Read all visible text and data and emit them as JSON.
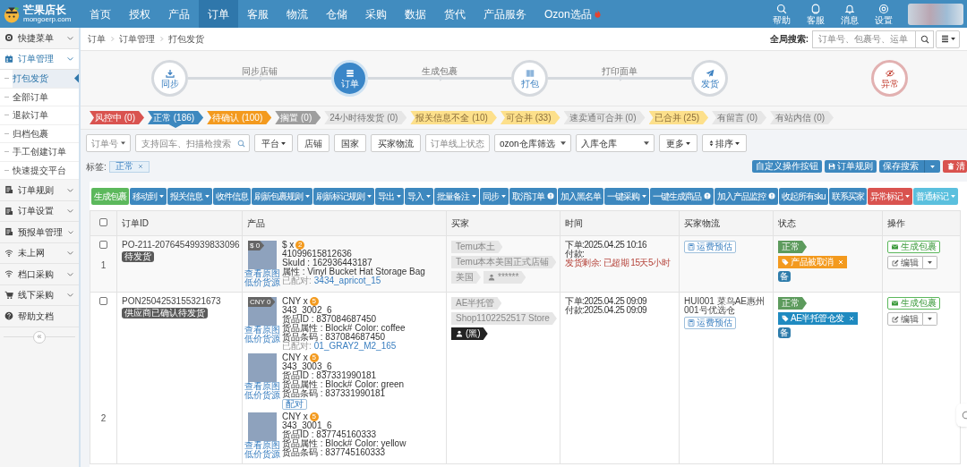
{
  "nav": {
    "logo": {
      "name": "芒果店长",
      "domain": "mongoerp.com"
    },
    "items": [
      {
        "label": "首页",
        "selected": false
      },
      {
        "label": "授权",
        "selected": false
      },
      {
        "label": "产品",
        "selected": false
      },
      {
        "label": "订单",
        "selected": true
      },
      {
        "label": "客服",
        "selected": false
      },
      {
        "label": "物流",
        "selected": false
      },
      {
        "label": "仓储",
        "selected": false
      },
      {
        "label": "采购",
        "selected": false
      },
      {
        "label": "数据",
        "selected": false
      },
      {
        "label": "货代",
        "selected": false
      },
      {
        "label": "产品服务",
        "selected": false
      },
      {
        "label": "Ozon选品",
        "selected": false,
        "hot": true
      }
    ],
    "tools": [
      {
        "label": "帮助",
        "kind": "search"
      },
      {
        "label": "客服",
        "kind": "support"
      },
      {
        "label": "消息",
        "kind": "bell"
      },
      {
        "label": "设置",
        "kind": "gear"
      }
    ]
  },
  "sidebar": {
    "items": [
      {
        "label": "快捷菜单",
        "kind": "target",
        "expanded": false
      },
      {
        "label": "订单管理",
        "kind": "grid",
        "expanded": true,
        "children": [
          {
            "label": "打包发货",
            "selected": true
          },
          {
            "label": "全部订单",
            "selected": false
          },
          {
            "label": "退款订单",
            "selected": false
          },
          {
            "label": "归档包裹",
            "selected": false
          },
          {
            "label": "手工创建订单",
            "selected": false
          },
          {
            "label": "快速提交平台",
            "selected": false
          }
        ]
      },
      {
        "label": "订单规则",
        "kind": "doc",
        "expanded": false
      },
      {
        "label": "订单设置",
        "kind": "doc",
        "expanded": false
      },
      {
        "label": "预报单管理",
        "kind": "doc",
        "expanded": false
      },
      {
        "label": "未上网",
        "kind": "wifi",
        "expanded": false
      },
      {
        "label": "档口采购",
        "kind": "wifi",
        "expanded": false
      },
      {
        "label": "线下采购",
        "kind": "cart",
        "expanded": false
      },
      {
        "label": "帮助文档",
        "kind": "help"
      }
    ],
    "collapse": "«"
  },
  "breadcrumb": [
    "订单",
    "订单管理",
    "打包发货"
  ],
  "global_search": {
    "label": "全局搜索:",
    "placeholder": "订单号、包裹号、运单"
  },
  "steps": [
    {
      "label": "同步",
      "kind": "normal",
      "active": false,
      "next_label": "同步店铺"
    },
    {
      "label": "订单",
      "kind": "normal",
      "active": true,
      "next_label": "生成包裹"
    },
    {
      "label": "打包",
      "kind": "normal",
      "active": false,
      "next_label": "打印面单"
    },
    {
      "label": "发货",
      "kind": "normal",
      "active": false
    },
    {
      "label": "异常",
      "kind": "error",
      "active": false
    }
  ],
  "status_tabs": [
    {
      "label": "风控中 (0)",
      "kind": "solid",
      "color": "#d9534f",
      "selected": false
    },
    {
      "label": "正常 (186)",
      "kind": "solid",
      "color": "#3d88bf",
      "selected": true
    },
    {
      "label": "待确认 (100)",
      "kind": "solid",
      "color": "#f39a1e",
      "selected": false
    },
    {
      "label": "搁置 (0)",
      "kind": "solid",
      "color": "#9e9e9e",
      "selected": false
    },
    {
      "label": "24小时待发货 (0)",
      "kind": "muted",
      "color": "#e6e6e6",
      "selected": false
    },
    {
      "label": "报关信息不全 (10)",
      "kind": "warn",
      "color": "#fde08b",
      "selected": false
    },
    {
      "label": "可合并 (33)",
      "kind": "warn",
      "color": "#fde08b",
      "selected": false
    },
    {
      "label": "速卖通可合并 (0)",
      "kind": "muted",
      "color": "#e6e6e6",
      "selected": false
    },
    {
      "label": "已合并 (25)",
      "kind": "warn",
      "color": "#fde08b",
      "selected": false
    },
    {
      "label": "有留言 (0)",
      "kind": "muted",
      "color": "#e6e6e6",
      "selected": false
    },
    {
      "label": "有站内信 (0)",
      "kind": "muted",
      "color": "#e6e6e6",
      "selected": false
    }
  ],
  "filters": [
    {
      "kind": "select",
      "placeholder": "订单号"
    },
    {
      "kind": "search",
      "placeholder": "支持回车、扫描枪搜索"
    },
    {
      "kind": "dropdown",
      "label": "平台"
    },
    {
      "kind": "button",
      "label": "店铺"
    },
    {
      "kind": "button",
      "label": "国家"
    },
    {
      "kind": "button",
      "label": "买家物流"
    },
    {
      "kind": "select",
      "placeholder": "订单线上状态"
    },
    {
      "kind": "select",
      "value": "ozon仓库筛选"
    },
    {
      "kind": "select",
      "value": "入库仓库"
    },
    {
      "kind": "dropdown",
      "label": "更多"
    },
    {
      "kind": "sort",
      "label": "排序"
    }
  ],
  "tags": {
    "label": "标签:",
    "items": [
      {
        "text": "正常"
      }
    ]
  },
  "tag_actions": [
    {
      "label": "自定义操作按钮",
      "kind": "plain"
    },
    {
      "label": "订单规则",
      "kind": "save"
    },
    {
      "label": "保存搜索",
      "kind": "split"
    },
    {
      "label": "清",
      "kind": "trash"
    }
  ],
  "toolbar": [
    {
      "label": "生成包裹",
      "kind": "success"
    },
    {
      "label": "移动到",
      "kind": "primary",
      "dropdown": true
    },
    {
      "label": "报关信息",
      "kind": "primary",
      "dropdown": true
    },
    {
      "label": "收件信息",
      "kind": "primary"
    },
    {
      "label": "刷新包裹规则",
      "kind": "primary",
      "dropdown": true
    },
    {
      "label": "刷新标记规则",
      "kind": "primary",
      "dropdown": true
    },
    {
      "label": "导出",
      "kind": "primary",
      "dropdown": true
    },
    {
      "label": "导入",
      "kind": "primary",
      "dropdown": true
    },
    {
      "label": "批量备注",
      "kind": "primary",
      "dropdown": true
    },
    {
      "label": "同步",
      "kind": "primary",
      "dropdown": true
    },
    {
      "label": "取消订单",
      "kind": "primary",
      "info": true
    },
    {
      "label": "加入黑名单",
      "kind": "primary"
    },
    {
      "label": "一键采购",
      "kind": "primary",
      "dropdown": true
    },
    {
      "label": "一键生成商品",
      "kind": "primary",
      "info": true
    },
    {
      "label": "加入产品监控",
      "kind": "primary",
      "info": true
    },
    {
      "label": "收起所有sku",
      "kind": "primary"
    },
    {
      "label": "联系买家",
      "kind": "primary"
    },
    {
      "label": "异常标记",
      "kind": "danger",
      "dropdown": true
    },
    {
      "label": "普通标记",
      "kind": "info",
      "dropdown": true
    }
  ],
  "table": {
    "select_all_checked": false,
    "columns": [
      "订单ID",
      "产品",
      "买家",
      "时间",
      "买家物流",
      "状态",
      "操作"
    ],
    "rows": [
      {
        "number": "1",
        "checked": false,
        "order_id": "PO-211-20764549939833096",
        "order_badge": "待发货",
        "products": [
          {
            "price_tag": "$ 0",
            "links": [
              "查看原图",
              "低价货源"
            ],
            "currency": "$ x",
            "qty": "2",
            "lines": [
              "41099615812636",
              "SkuId : 162936443187",
              "属性 : Vinyl Bucket Hat Storage Bag"
            ],
            "paired_label": "已配对:",
            "paired": "3434_apricot_15"
          }
        ],
        "buyer": [
          {
            "text": "Temu本土",
            "kind": "light"
          },
          {
            "text": "Temu本本美国正式店铺",
            "kind": "light"
          },
          {
            "text": "美国",
            "kind": "light"
          },
          {
            "text": "******",
            "kind": "user_light"
          }
        ],
        "time": [
          {
            "text": "下单:2025.04.25 10:16",
            "kind": "normal"
          },
          {
            "text": "付款:",
            "kind": "normal"
          },
          {
            "text": "发货剩余: 已超期 15天5小时",
            "kind": "alert"
          }
        ],
        "logistics": {
          "estimate": "运费预估"
        },
        "status": {
          "state": "正常",
          "mark": {
            "text": "产品被取消",
            "color": "#f39a1e"
          },
          "note": "备"
        },
        "actions": {
          "primary": "生成包裹",
          "edit": "编辑"
        }
      },
      {
        "number": "2",
        "checked": false,
        "order_id": "PON2504253155321673",
        "order_badge": "供应商已确认待发货",
        "products": [
          {
            "price_tag": "CNY 0",
            "links": [
              "查看原图",
              "低价货源"
            ],
            "currency": "CNY x",
            "qty": "5",
            "lines": [
              "343_3002_6",
              "货品ID : 837084687450",
              "货品属性 : Block# Color: coffee",
              "货品条码 : 837084687450"
            ],
            "paired_label": "已配对:",
            "paired": "01_GRAY2_M2_165"
          },
          {
            "links": [
              "查看原图",
              "低价货源"
            ],
            "currency": "CNY x",
            "qty": "5",
            "lines": [
              "343_3003_6",
              "货品ID : 837331990181",
              "货品属性 : Block# Color: green",
              "货品条码 : 837331990181"
            ],
            "pair_button": "配对"
          },
          {
            "links": [
              "查看原图",
              "低价货源"
            ],
            "currency": "CNY x",
            "qty": "5",
            "lines": [
              "343_3001_6",
              "货品ID : 837745160333",
              "货品属性 : Block# Color: yellow",
              "货品条码 : 837745160333"
            ]
          }
        ],
        "buyer": [
          {
            "text": "AE半托管",
            "kind": "light"
          },
          {
            "text": "Shop1102252517 Store",
            "kind": "light"
          },
          {
            "text": "(黑)",
            "kind": "user_dark"
          }
        ],
        "time": [
          {
            "text": "下单:2025.04.25 09:09",
            "kind": "normal"
          },
          {
            "text": "付款:2025.04.25 09:09",
            "kind": "normal"
          }
        ],
        "logistics": {
          "text": "HUI001 菜鸟AE惠州001号优选仓",
          "estimate": "运费预估"
        },
        "status": {
          "state": "正常",
          "mark": {
            "text": "AE半托管仓发",
            "color": "#1f8ac0"
          },
          "note": "备"
        },
        "actions": {
          "primary": "生成包裹",
          "edit": "编辑"
        }
      }
    ]
  }
}
